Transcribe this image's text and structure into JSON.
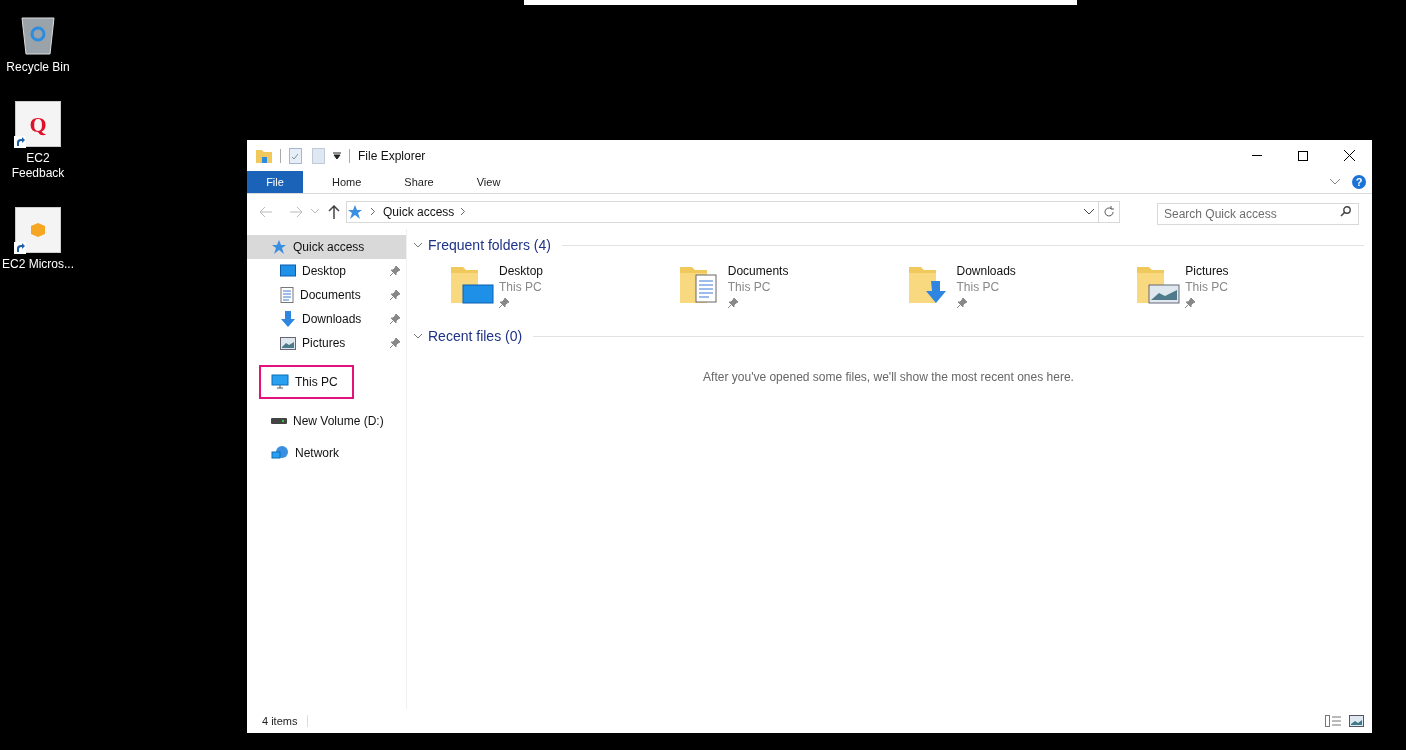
{
  "desktop_icons": [
    {
      "label": "Recycle Bin",
      "kind": "recycle",
      "shortcut": false
    },
    {
      "label": "EC2 Feedback",
      "kind": "feedback",
      "shortcut": true,
      "logo_text": "Q"
    },
    {
      "label": "EC2 Micros...",
      "kind": "box",
      "shortcut": true
    }
  ],
  "window": {
    "title": "File Explorer",
    "ribbon_tabs": [
      {
        "label": "File",
        "selected": true
      },
      {
        "label": "Home",
        "selected": false
      },
      {
        "label": "Share",
        "selected": false
      },
      {
        "label": "View",
        "selected": false
      }
    ],
    "help_label": "?",
    "address": {
      "path": "Quick access"
    },
    "search": {
      "placeholder": "Search Quick access"
    },
    "nav": [
      {
        "label": "Quick access",
        "kind": "star",
        "selected": true,
        "highlighted": false,
        "children": [
          {
            "label": "Desktop",
            "kind": "desktop",
            "pinned": true,
            "selected": false,
            "highlighted": false
          },
          {
            "label": "Documents",
            "kind": "documents",
            "pinned": true,
            "selected": false,
            "highlighted": false
          },
          {
            "label": "Downloads",
            "kind": "downloads",
            "pinned": true,
            "selected": false,
            "highlighted": false
          },
          {
            "label": "Pictures",
            "kind": "pictures",
            "pinned": true,
            "selected": false,
            "highlighted": false
          }
        ]
      },
      {
        "label": "This PC",
        "kind": "pc",
        "selected": false,
        "highlighted": true
      },
      {
        "label": "New Volume (D:)",
        "kind": "drive",
        "selected": false,
        "highlighted": false
      },
      {
        "label": "Network",
        "kind": "network",
        "selected": false,
        "highlighted": false
      }
    ],
    "sections": [
      {
        "title": "Frequent folders (4)",
        "expanded": true,
        "folders": [
          {
            "name": "Desktop",
            "location": "This PC",
            "kind": "desktop",
            "pinned": true
          },
          {
            "name": "Documents",
            "location": "This PC",
            "kind": "documents",
            "pinned": true
          },
          {
            "name": "Downloads",
            "location": "This PC",
            "kind": "downloads",
            "pinned": true
          },
          {
            "name": "Pictures",
            "location": "This PC",
            "kind": "pictures",
            "pinned": true
          }
        ]
      },
      {
        "title": "Recent files (0)",
        "expanded": true,
        "message": "After you've opened some files, we'll show the most recent ones here."
      }
    ],
    "status_bar": {
      "count": "4 items"
    }
  }
}
